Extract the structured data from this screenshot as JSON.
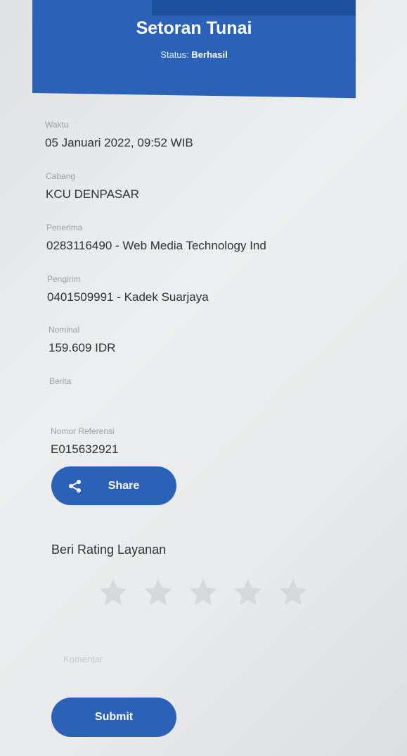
{
  "header": {
    "title": "Setoran Tunai",
    "status_label": "Status:",
    "status_value": "Berhasil"
  },
  "details": {
    "waktu_label": "Waktu",
    "waktu_value": "05 Januari 2022, 09:52 WIB",
    "cabang_label": "Cabang",
    "cabang_value": "KCU DENPASAR",
    "penerima_label": "Penerima",
    "penerima_value": "0283116490 - Web Media Technology Ind",
    "pengirim_label": "Pengirim",
    "pengirim_value": "0401509991 - Kadek Suarjaya",
    "nominal_label": "Nominal",
    "nominal_value": "159.609 IDR",
    "berita_label": "Berita",
    "berita_value": "",
    "referensi_label": "Nomor Referensi",
    "referensi_value": "E015632921"
  },
  "actions": {
    "share_label": "Share",
    "share_icon": "share-icon",
    "submit_label": "Submit"
  },
  "rating": {
    "title": "Beri Rating Layanan",
    "stars_selected": 0,
    "stars_total": 5,
    "comment_placeholder": "Komentar"
  },
  "colors": {
    "primary": "#2b62b8",
    "star_inactive": "#d6d8da"
  }
}
